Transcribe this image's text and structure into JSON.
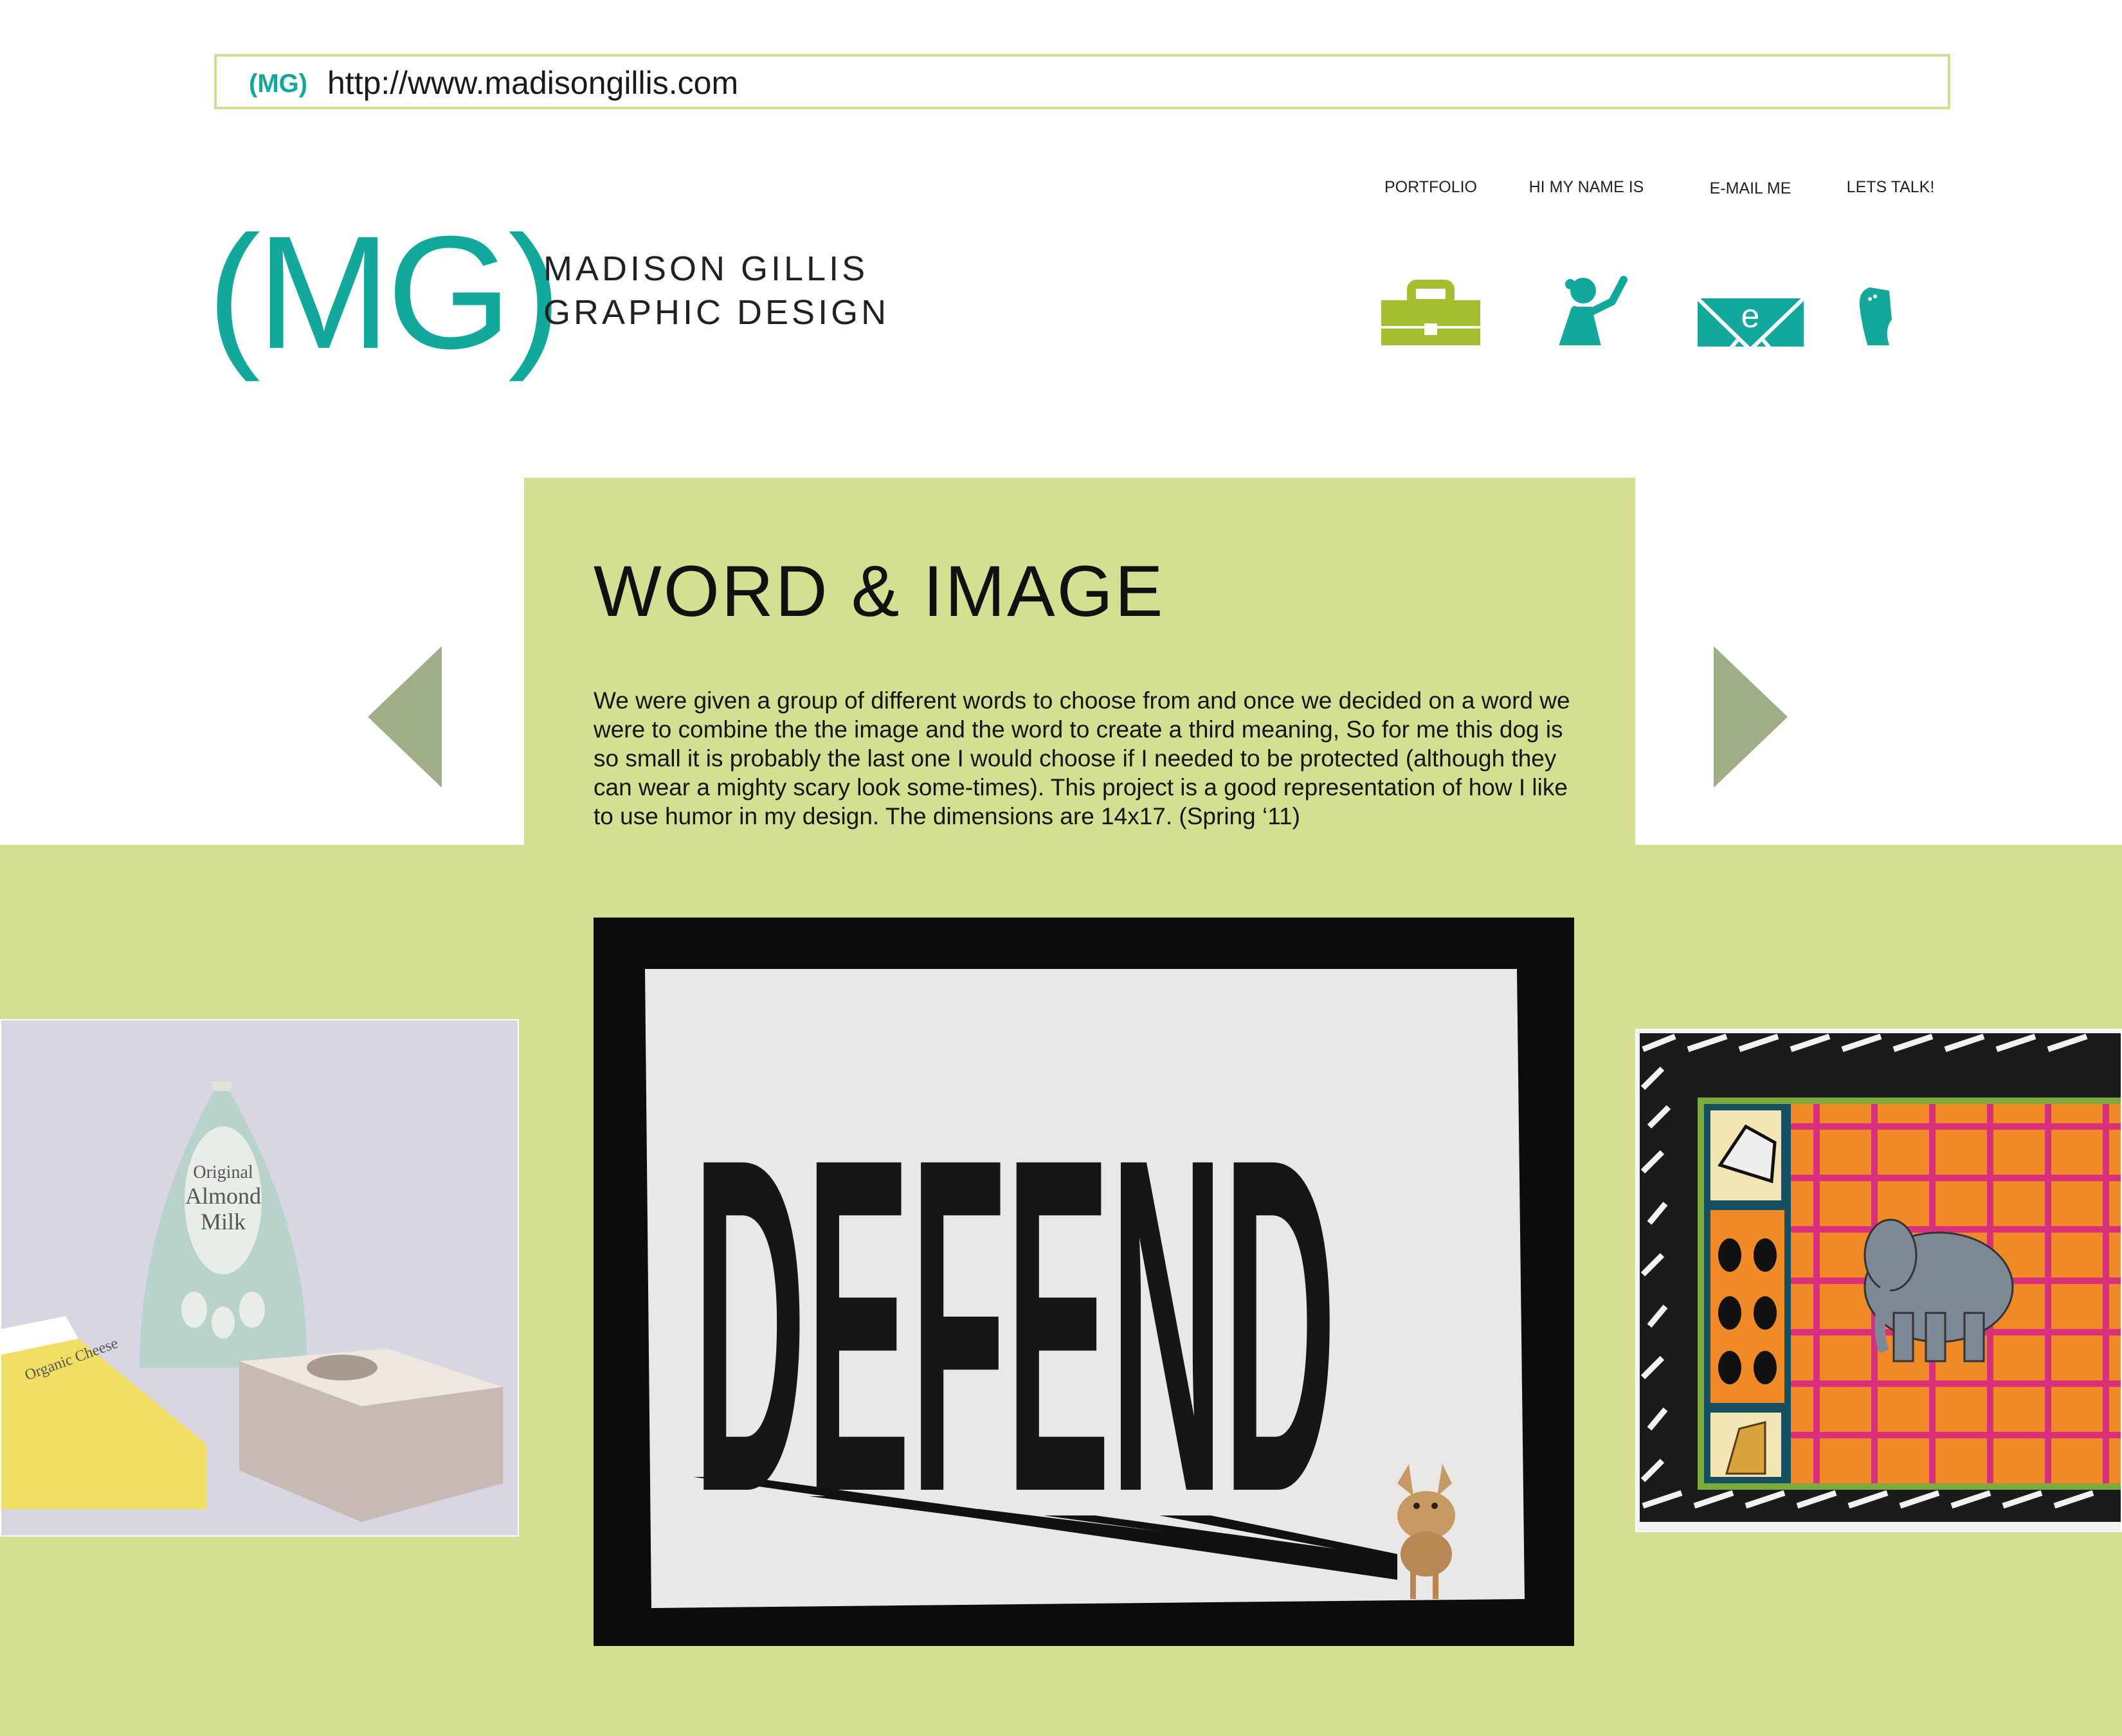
{
  "url_bar": {
    "mark": "(MG)",
    "url": "http://www.madisongillis.com"
  },
  "logo": {
    "mark": "(MG)",
    "line1": "MADISON GILLIS",
    "line2": "GRAPHIC DESIGN"
  },
  "nav": [
    {
      "label": "PORTFOLIO",
      "icon": "briefcase-icon"
    },
    {
      "label": "HI MY NAME IS",
      "icon": "girl-waving-icon"
    },
    {
      "label": "E-MAIL ME",
      "icon": "envelope-icon"
    },
    {
      "label": "LETS TALK!",
      "icon": "phone-icon"
    }
  ],
  "section": {
    "title": "WORD & IMAGE",
    "description": "We were given a group of different words to choose from and once we decided on a word we were to combine the the image and the word to create a third meaning, So for me this dog is so small it is probably the last one I would choose if I needed to be protected (although they can wear a mighty scary look some-times). This project is a good representation of how I like to use humor in my design. The dimensions are 14x17. (Spring ‘11)"
  },
  "gallery": {
    "main": {
      "word": "DEFEND"
    },
    "left": {
      "label_line1": "Original",
      "label_line2": "Almond",
      "label_line3": "Milk",
      "box_label": "Organic Cheese"
    },
    "right": {}
  },
  "colors": {
    "teal": "#12a89b",
    "lime": "#a3bf2f",
    "pale_green": "#d4df92",
    "arrow": "#9fae87"
  }
}
